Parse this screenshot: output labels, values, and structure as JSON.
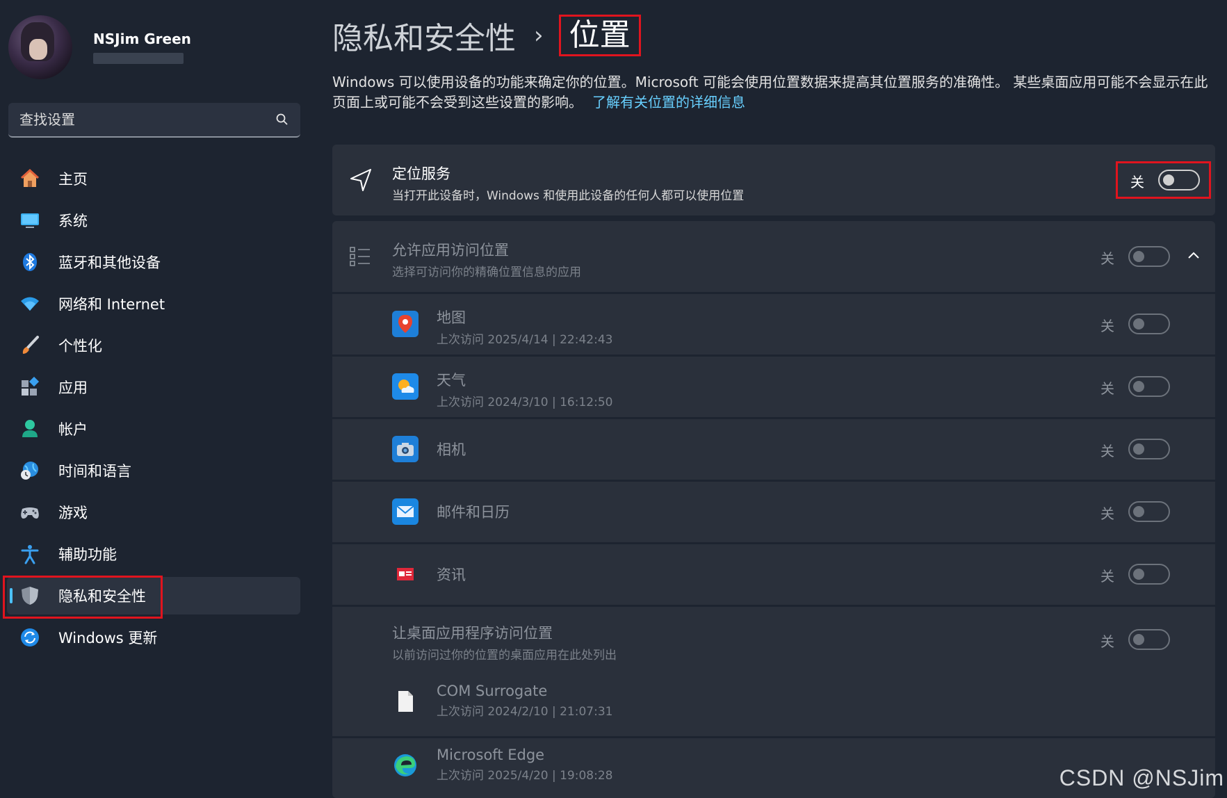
{
  "profile": {
    "name": "NSJim Green"
  },
  "search": {
    "placeholder": "查找设置"
  },
  "sidebar": {
    "items": [
      {
        "label": "主页",
        "icon": "home-icon"
      },
      {
        "label": "系统",
        "icon": "monitor-icon"
      },
      {
        "label": "蓝牙和其他设备",
        "icon": "bluetooth-icon"
      },
      {
        "label": "网络和 Internet",
        "icon": "wifi-icon"
      },
      {
        "label": "个性化",
        "icon": "brush-icon"
      },
      {
        "label": "应用",
        "icon": "apps-icon"
      },
      {
        "label": "帐户",
        "icon": "account-icon"
      },
      {
        "label": "时间和语言",
        "icon": "globe-clock-icon"
      },
      {
        "label": "游戏",
        "icon": "gamepad-icon"
      },
      {
        "label": "辅助功能",
        "icon": "accessibility-icon"
      },
      {
        "label": "隐私和安全性",
        "icon": "shield-icon",
        "active": true
      },
      {
        "label": "Windows 更新",
        "icon": "update-icon"
      }
    ]
  },
  "header": {
    "parent": "隐私和安全性",
    "separator": "›",
    "current": "位置"
  },
  "description": {
    "text": "Windows 可以使用设备的功能来确定你的位置。Microsoft 可能会使用位置数据来提高其位置服务的准确性。 某些桌面应用可能不会显示在此页面上或可能不会受到这些设置的影响。",
    "link": "了解有关位置的详细信息"
  },
  "location_service": {
    "title": "定位服务",
    "subtitle": "当打开此设备时，Windows 和使用此设备的任何人都可以使用位置",
    "state": "关"
  },
  "app_access": {
    "title": "允许应用访问位置",
    "subtitle": "选择可访问你的精确位置信息的应用",
    "state": "关",
    "apps": [
      {
        "name": "地图",
        "last": "上次访问 2025/4/14  |  22:42:43",
        "state": "关",
        "icon": "maps-icon"
      },
      {
        "name": "天气",
        "last": "上次访问 2024/3/10  |  16:12:50",
        "state": "关",
        "icon": "weather-icon"
      },
      {
        "name": "相机",
        "last": "",
        "state": "关",
        "icon": "camera-icon"
      },
      {
        "name": "邮件和日历",
        "last": "",
        "state": "关",
        "icon": "mail-icon"
      },
      {
        "name": "资讯",
        "last": "",
        "state": "关",
        "icon": "news-icon"
      }
    ]
  },
  "desktop_access": {
    "title": "让桌面应用程序访问位置",
    "subtitle": "以前访问过你的位置的桌面应用在此处列出",
    "state": "关",
    "apps": [
      {
        "name": "COM Surrogate",
        "last": "上次访问 2024/2/10  |  21:07:31",
        "icon": "file-icon"
      },
      {
        "name": "Microsoft Edge",
        "last": "上次访问 2025/4/20  |  19:08:28",
        "icon": "edge-icon"
      }
    ]
  },
  "watermark": "CSDN @NSJim",
  "colors": {
    "accent": "#4cc2ff",
    "highlight": "#e0141e",
    "link": "#68d0ff"
  }
}
